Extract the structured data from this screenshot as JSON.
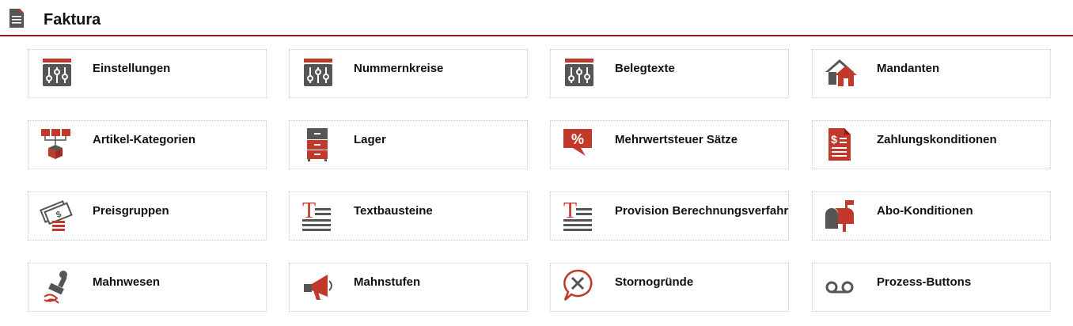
{
  "header": {
    "title": "Faktura",
    "icon": "document-icon"
  },
  "colors": {
    "accent": "#c0392b",
    "dark": "#555555",
    "rule": "#8b1a14"
  },
  "tiles": [
    {
      "label": "Einstellungen",
      "icon": "sliders-icon"
    },
    {
      "label": "Nummernkreise",
      "icon": "sliders-icon"
    },
    {
      "label": "Belegtexte",
      "icon": "sliders-icon"
    },
    {
      "label": "Mandanten",
      "icon": "houses-icon"
    },
    {
      "label": "Artikel-Kategorien",
      "icon": "category-tree-icon"
    },
    {
      "label": "Lager",
      "icon": "warehouse-cabinet-icon"
    },
    {
      "label": "Mehrwertsteuer Sätze",
      "icon": "percent-bubble-icon"
    },
    {
      "label": "Zahlungskonditionen",
      "icon": "dollar-document-icon"
    },
    {
      "label": "Preisgruppen",
      "icon": "money-stack-icon"
    },
    {
      "label": "Textbausteine",
      "icon": "text-block-icon"
    },
    {
      "label": "Provision Berechnungsverfahr",
      "icon": "text-block-icon"
    },
    {
      "label": "Abo-Konditionen",
      "icon": "mailbox-icon"
    },
    {
      "label": "Mahnwesen",
      "icon": "stamp-icon"
    },
    {
      "label": "Mahnstufen",
      "icon": "megaphone-icon"
    },
    {
      "label": "Stornogründe",
      "icon": "cancel-bubble-icon"
    },
    {
      "label": "Prozess-Buttons",
      "icon": "voicemail-icon"
    }
  ]
}
